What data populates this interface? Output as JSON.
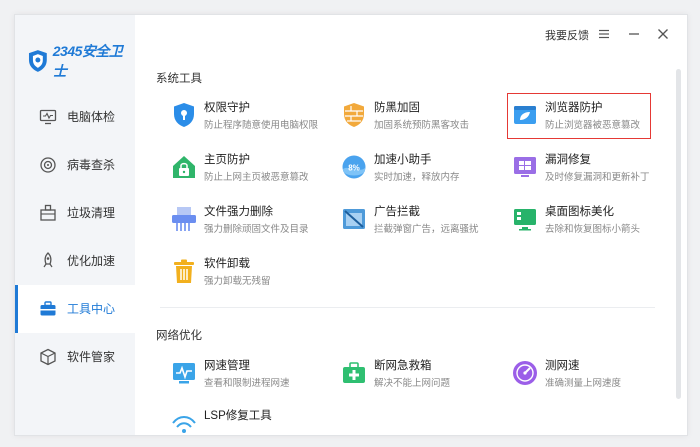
{
  "app": {
    "logo_text": "2345安全卫士"
  },
  "topbar": {
    "feedback_label": "我要反馈"
  },
  "sidebar": {
    "items": [
      {
        "label": "电脑体检",
        "icon": "monitor-check-icon"
      },
      {
        "label": "病毒查杀",
        "icon": "virus-scan-icon"
      },
      {
        "label": "垃圾清理",
        "icon": "trash-clean-icon"
      },
      {
        "label": "优化加速",
        "icon": "rocket-icon"
      },
      {
        "label": "工具中心",
        "icon": "toolbox-icon",
        "active": true
      },
      {
        "label": "软件管家",
        "icon": "box-icon"
      }
    ]
  },
  "sections": {
    "system_tools": {
      "title": "系统工具",
      "tools": [
        {
          "name": "权限守护",
          "desc": "防止程序随意使用电脑权限",
          "icon": "shield-lock-icon"
        },
        {
          "name": "防黑加固",
          "desc": "加固系统预防黑客攻击",
          "icon": "firewall-shield-icon"
        },
        {
          "name": "浏览器防护",
          "desc": "防止浏览器被恶意篡改",
          "icon": "browser-shield-icon"
        },
        {
          "name": "主页防护",
          "desc": "防止上网主页被恶意篡改",
          "icon": "home-lock-icon"
        },
        {
          "name": "加速小助手",
          "desc": "实时加速，释放内存",
          "icon": "memory-ball-icon"
        },
        {
          "name": "漏洞修复",
          "desc": "及时修复漏洞和更新补丁",
          "icon": "windows-patch-icon"
        },
        {
          "name": "文件强力删除",
          "desc": "强力删除顽固文件及目录",
          "icon": "shredder-icon"
        },
        {
          "name": "广告拦截",
          "desc": "拦截弹窗广告，远离骚扰",
          "icon": "ad-block-icon"
        },
        {
          "name": "桌面图标美化",
          "desc": "去除和恢复图标小箭头",
          "icon": "desktop-icon"
        },
        {
          "name": "软件卸载",
          "desc": "强力卸载无残留",
          "icon": "uninstall-bin-icon"
        }
      ]
    },
    "network": {
      "title": "网络优化",
      "tools": [
        {
          "name": "网速管理",
          "desc": "查看和限制进程网速",
          "icon": "speed-monitor-icon"
        },
        {
          "name": "断网急救箱",
          "desc": "解决不能上网问题",
          "icon": "first-aid-kit-icon"
        },
        {
          "name": "测网速",
          "desc": "准确测量上网速度",
          "icon": "speedometer-icon"
        },
        {
          "name": "LSP修复工具",
          "desc": "",
          "icon": "wifi-repair-icon"
        }
      ]
    }
  },
  "colors": {
    "accent": "#1f7ad6",
    "highlight_border": "#e53935"
  }
}
